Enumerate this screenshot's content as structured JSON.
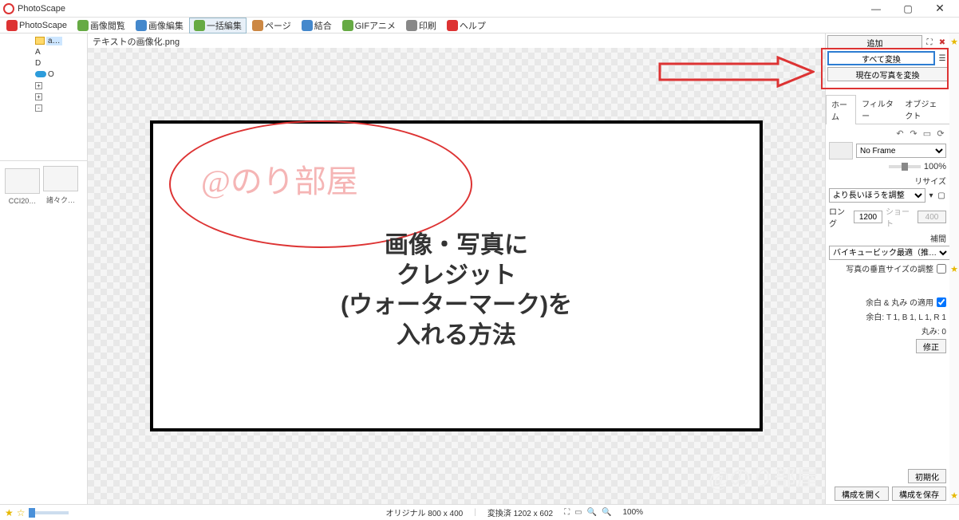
{
  "app": {
    "title": "PhotoScape"
  },
  "window": {
    "min": "—",
    "max": "▢",
    "close": "✕"
  },
  "toolbar": {
    "items": [
      {
        "label": "PhotoScape",
        "icon": "logo-icon",
        "active": false
      },
      {
        "label": "画像閲覧",
        "icon": "browse-icon",
        "active": false
      },
      {
        "label": "画像編集",
        "icon": "edit-icon",
        "active": false
      },
      {
        "label": "一括編集",
        "icon": "batch-icon",
        "active": true
      },
      {
        "label": "ページ",
        "icon": "page-icon",
        "active": false
      },
      {
        "label": "結合",
        "icon": "combine-icon",
        "active": false
      },
      {
        "label": "GIFアニメ",
        "icon": "gif-icon",
        "active": false
      },
      {
        "label": "印刷",
        "icon": "print-icon",
        "active": false
      },
      {
        "label": "ヘルプ",
        "icon": "help-icon",
        "active": false
      }
    ]
  },
  "tree": {
    "items": [
      {
        "indent": 40,
        "exp": "",
        "kind": "folder",
        "label": "a…",
        "selected": true
      },
      {
        "indent": 40,
        "exp": "",
        "kind": "none",
        "label": "A"
      },
      {
        "indent": 40,
        "exp": "",
        "kind": "none",
        "label": "D"
      },
      {
        "indent": 40,
        "exp": "",
        "kind": "cloud",
        "label": "O"
      },
      {
        "indent": 40,
        "exp": "+",
        "kind": "none",
        "label": ""
      },
      {
        "indent": 40,
        "exp": "+",
        "kind": "none",
        "label": ""
      },
      {
        "indent": 40,
        "exp": "-",
        "kind": "none",
        "label": ""
      },
      {
        "indent": 52,
        "exp": "",
        "kind": "none",
        "label": ""
      },
      {
        "indent": 52,
        "exp": "",
        "kind": "none",
        "label": ""
      },
      {
        "indent": 52,
        "exp": "",
        "kind": "none",
        "label": ""
      },
      {
        "indent": 52,
        "exp": "",
        "kind": "none",
        "label": ""
      }
    ]
  },
  "thumbs": [
    {
      "label": "CCI20…"
    },
    {
      "label": "諸々ク…"
    }
  ],
  "file": {
    "name": "テキストの画像化.png"
  },
  "canvas": {
    "watermark": "@のり部屋",
    "lines": [
      "画像・写真に",
      "クレジット",
      "(ウォーターマーク)を",
      "入れる方法"
    ]
  },
  "top_buttons": {
    "add": "追加",
    "convert_all": "すべて変換",
    "convert_current": "現在の写真を変換"
  },
  "tabs": {
    "home": "ホーム",
    "filter": "フィルター",
    "object": "オブジェクト"
  },
  "panel": {
    "frame_label": "No Frame",
    "zoom_pct": "100%",
    "resize_title": "リサイズ",
    "resize_mode": "より長いほうを調整",
    "long_label": "ロング",
    "long_value": "1200",
    "short_label": "ショート",
    "short_value": "400",
    "interp_title": "補間",
    "interp_mode": "バイキュービック最適（推…",
    "vsize_label": "写真の垂直サイズの調整",
    "margin_apply_label": "余白 & 丸み の適用",
    "margin_text": "余白: T 1, B 1, L 1, R 1",
    "round_text": "丸み: 0",
    "modify_btn": "修正"
  },
  "bottom": {
    "open": "構成を開く",
    "save": "構成を保存",
    "reset": "初期化"
  },
  "status": {
    "original": "オリジナル 800 x 400",
    "converted": "変換済 1202 x 602",
    "zoom": "100%"
  }
}
